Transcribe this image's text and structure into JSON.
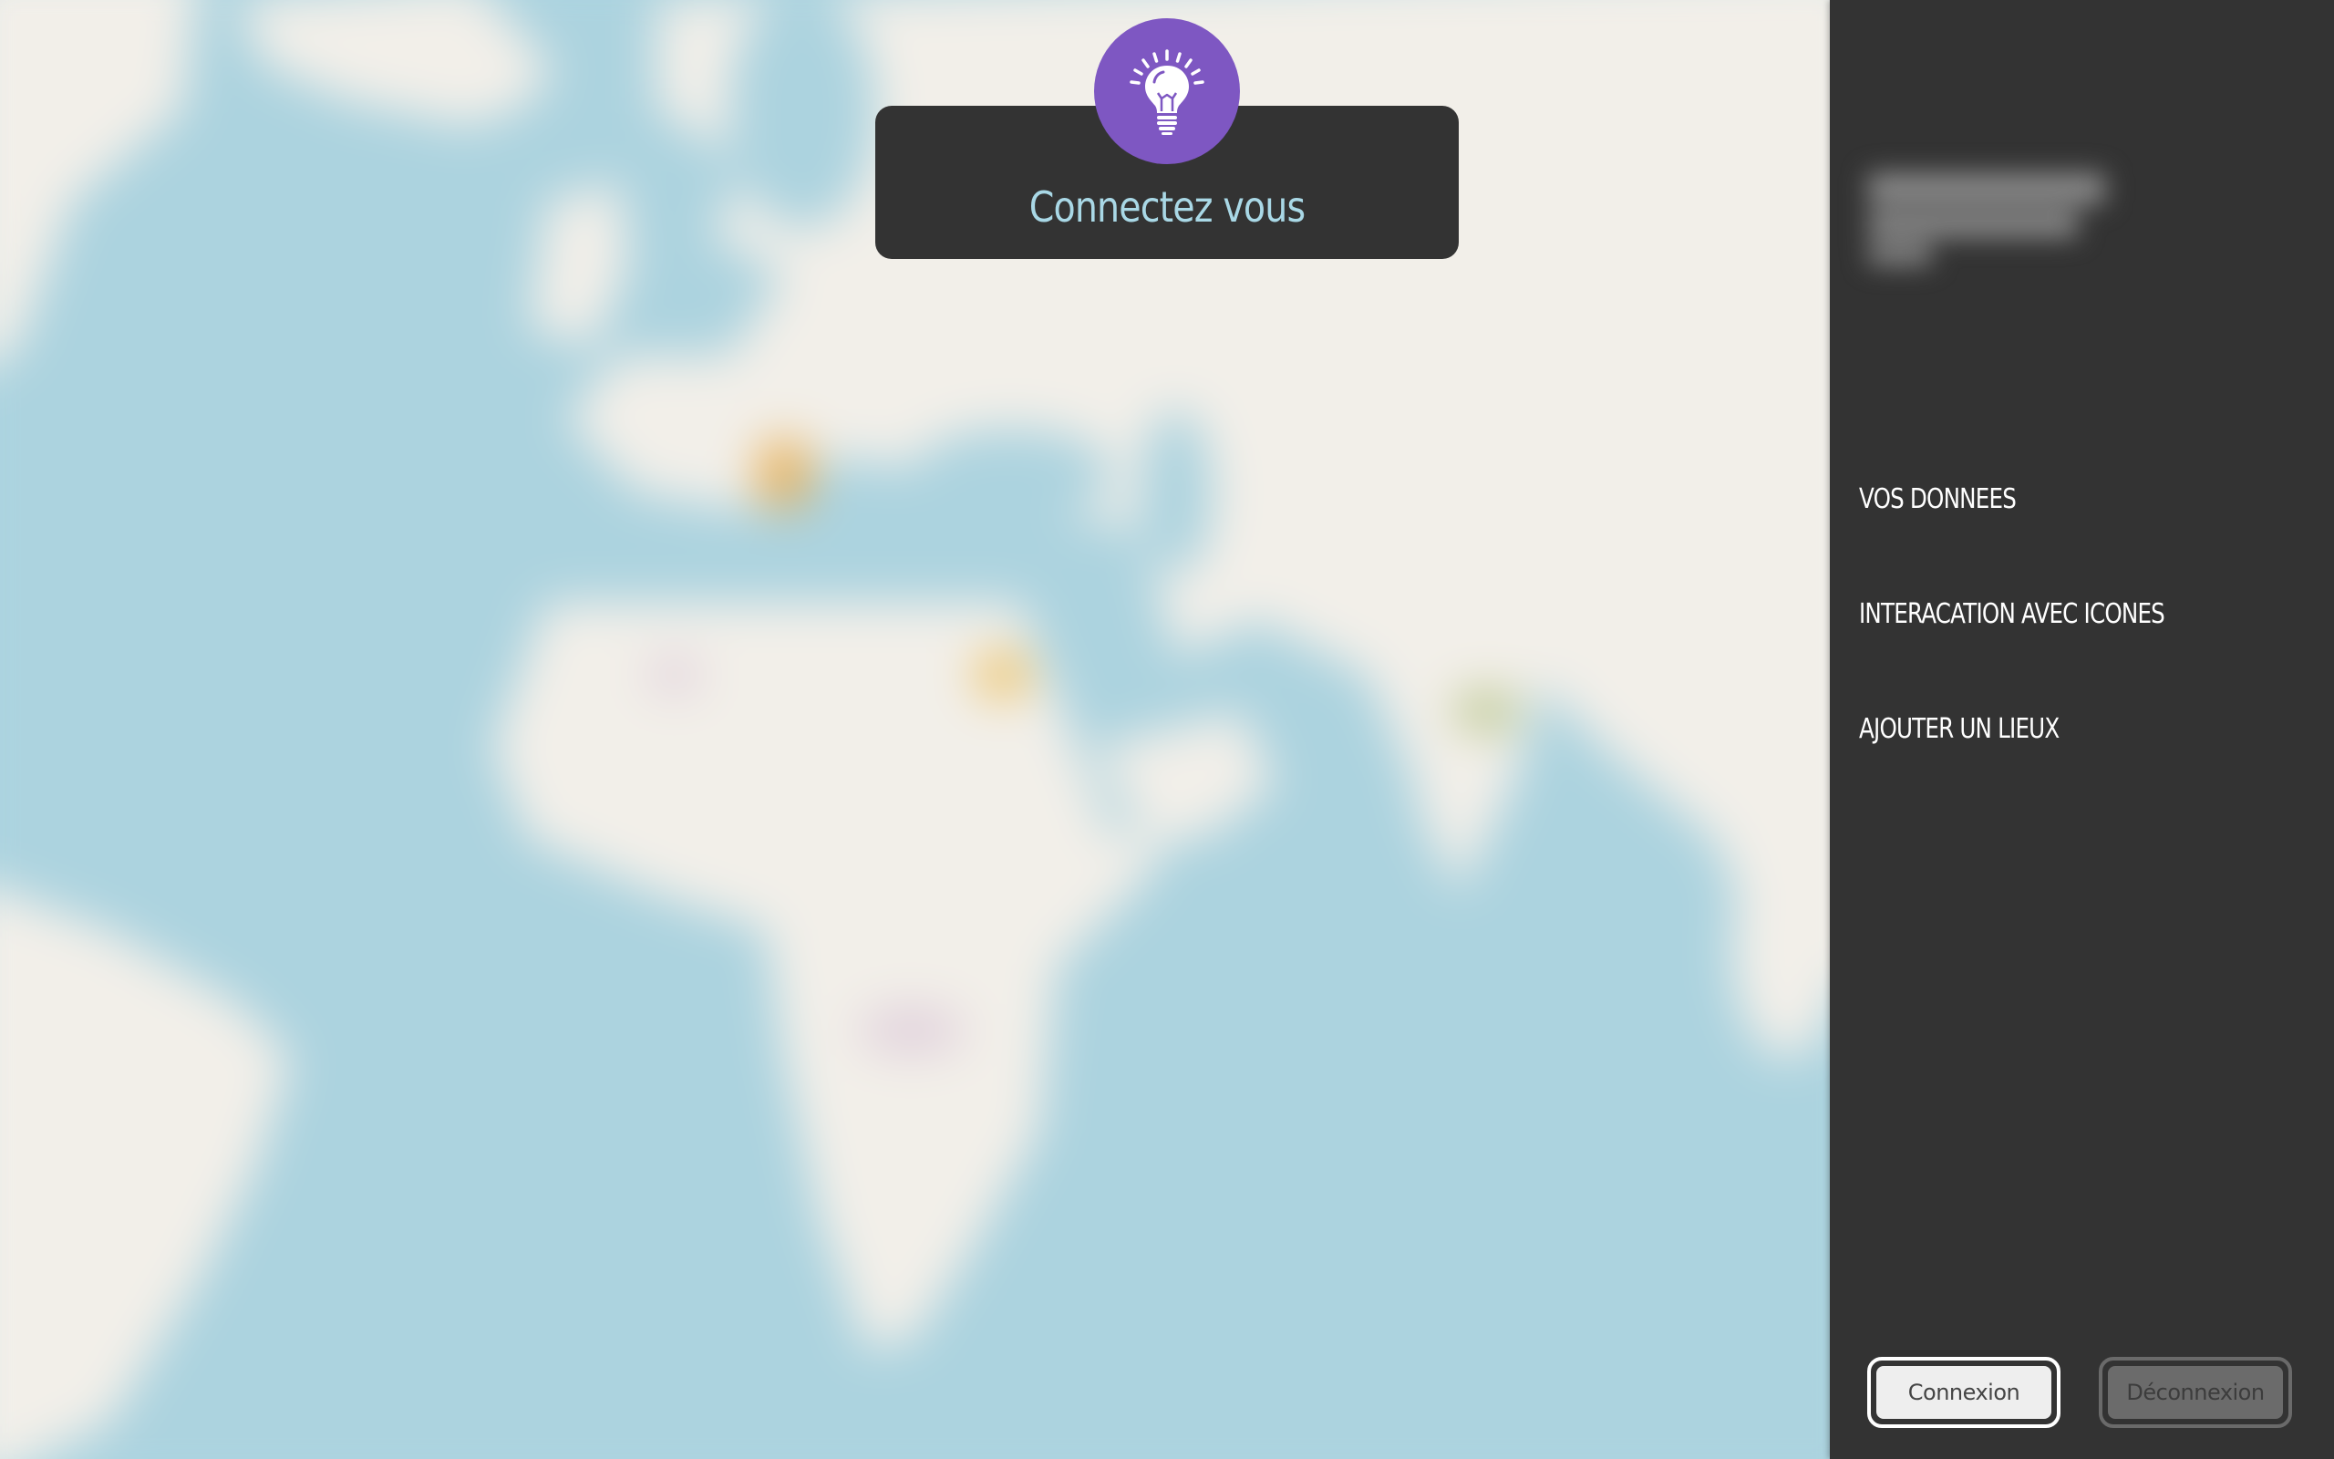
{
  "login_card": {
    "title": "Connectez vous",
    "icon": "lightbulb-icon",
    "badge_color": "#7e57c2",
    "title_color": "#a9d8e6"
  },
  "map": {
    "ocean_color": "#acd3df",
    "land_color": "#f2efe9"
  },
  "sidebar": {
    "background": "#333333",
    "nav_items": [
      {
        "label": "VOS DONNEES"
      },
      {
        "label": "INTERACATION AVEC ICONES"
      },
      {
        "label": "AJOUTER UN LIEUX"
      }
    ],
    "buttons": {
      "login_label": "Connexion",
      "logout_label": "Déconnexion"
    }
  }
}
